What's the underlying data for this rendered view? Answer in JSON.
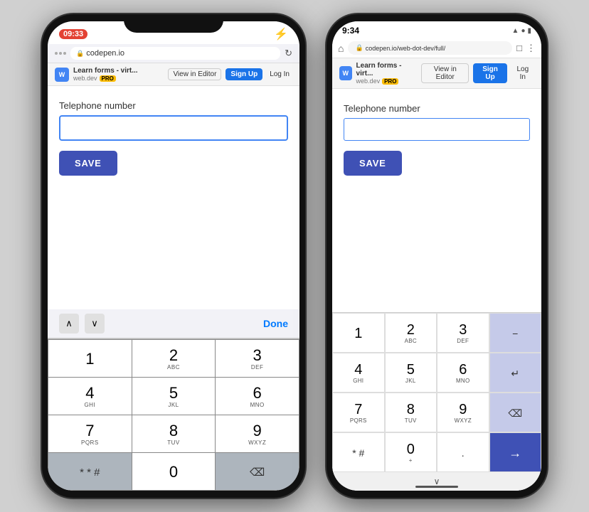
{
  "phones": {
    "left": {
      "type": "ios",
      "status": {
        "time": "09:33",
        "battery_color": "#e34234"
      },
      "browser": {
        "url": "codepen.io",
        "reload": "↻"
      },
      "toolbar": {
        "logo": "W",
        "site": "Learn forms - virt...",
        "sub": "web.dev",
        "pro": "PRO",
        "view_in_editor": "View in Editor",
        "sign_up": "Sign Up",
        "log_in": "Log In"
      },
      "page": {
        "field_label": "Telephone number",
        "save_btn": "SAVE"
      },
      "keyboard_nav": {
        "done": "Done"
      },
      "keys": [
        {
          "num": "1",
          "letters": "",
          "row": 1
        },
        {
          "num": "2",
          "letters": "ABC",
          "row": 1
        },
        {
          "num": "3",
          "letters": "DEF",
          "row": 1
        },
        {
          "num": "4",
          "letters": "GHI",
          "row": 2
        },
        {
          "num": "5",
          "letters": "JKL",
          "row": 2
        },
        {
          "num": "6",
          "letters": "MNO",
          "row": 2
        },
        {
          "num": "7",
          "letters": "PQRS",
          "row": 3
        },
        {
          "num": "8",
          "letters": "TUV",
          "row": 3
        },
        {
          "num": "9",
          "letters": "WXYZ",
          "row": 3
        },
        {
          "num": "* # #",
          "letters": "",
          "row": 4,
          "dark": true
        },
        {
          "num": "0",
          "letters": "",
          "row": 4
        },
        {
          "num": "⌫",
          "letters": "",
          "row": 4,
          "dark": true
        }
      ]
    },
    "right": {
      "type": "android",
      "status": {
        "time": "9:34",
        "icons": "⬡ ▣ ✦ ◎ •"
      },
      "browser": {
        "url": "codepen.io/web-dot-dev/full/",
        "home": "⌂",
        "lock": "🔒",
        "tabs": "□",
        "menu": "⋮"
      },
      "toolbar": {
        "logo": "W",
        "site": "Learn forms - virt...",
        "sub": "web.dev",
        "pro": "PRO",
        "view_in_editor": "View in Editor",
        "sign_up": "Sign Up",
        "log_in": "Log In"
      },
      "page": {
        "field_label": "Telephone number",
        "save_btn": "SAVE"
      },
      "keys": [
        {
          "num": "1",
          "letters": "",
          "col": 1
        },
        {
          "num": "2",
          "letters": "ABC",
          "col": 2
        },
        {
          "num": "3",
          "letters": "DEF",
          "col": 3
        },
        {
          "num": "−",
          "letters": "",
          "col": 4,
          "dark": true
        },
        {
          "num": "4",
          "letters": "GHI",
          "col": 1
        },
        {
          "num": "5",
          "letters": "JKL",
          "col": 2
        },
        {
          "num": "6",
          "letters": "MNO",
          "col": 3
        },
        {
          "num": "↵",
          "letters": "",
          "col": 4,
          "dark": true
        },
        {
          "num": "7",
          "letters": "PQRS",
          "col": 1
        },
        {
          "num": "8",
          "letters": "TUV",
          "col": 2
        },
        {
          "num": "9",
          "letters": "WXYZ",
          "col": 3
        },
        {
          "num": "⌫",
          "letters": "",
          "col": 4,
          "dark": true
        },
        {
          "num": "* #",
          "letters": "",
          "col": 1
        },
        {
          "num": "0",
          "letters": "+",
          "col": 2
        },
        {
          "num": ".",
          "letters": "",
          "col": 3
        },
        {
          "num": "→",
          "letters": "",
          "col": 4,
          "active": true
        }
      ],
      "bottom_bar": {
        "chevron": "∨"
      }
    }
  }
}
